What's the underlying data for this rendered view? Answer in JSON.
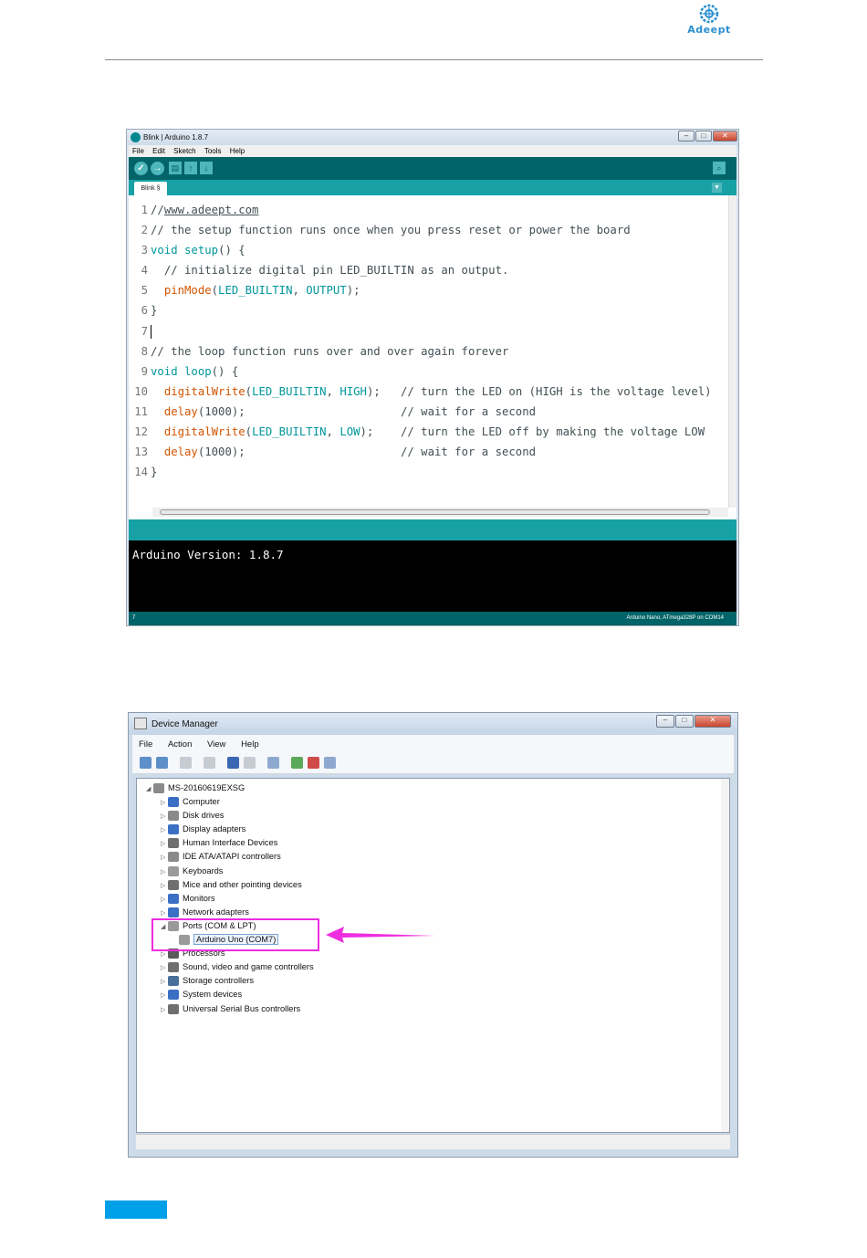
{
  "brand": {
    "logo_text": "Adeept"
  },
  "arduino": {
    "title": "Blink | Arduino 1.8.7",
    "menu": [
      "File",
      "Edit",
      "Sketch",
      "Tools",
      "Help"
    ],
    "tab": "Blink §",
    "code_lines": [
      {
        "n": "1",
        "text": "//www.adeept.com"
      },
      {
        "n": "2",
        "text": "// the setup function runs once when you press reset or power the board"
      },
      {
        "n": "3",
        "text": "void setup() {"
      },
      {
        "n": "4",
        "text": "  // initialize digital pin LED_BUILTIN as an output."
      },
      {
        "n": "5",
        "text": "  pinMode(LED_BUILTIN, OUTPUT);"
      },
      {
        "n": "6",
        "text": "}"
      },
      {
        "n": "7",
        "text": ""
      },
      {
        "n": "8",
        "text": "// the loop function runs over and over again forever"
      },
      {
        "n": "9",
        "text": "void loop() {"
      },
      {
        "n": "10",
        "text": "  digitalWrite(LED_BUILTIN, HIGH);   // turn the LED on (HIGH is the voltage level)"
      },
      {
        "n": "11",
        "text": "  delay(1000);                       // wait for a second"
      },
      {
        "n": "12",
        "text": "  digitalWrite(LED_BUILTIN, LOW);    // turn the LED off by making the voltage LOW"
      },
      {
        "n": "13",
        "text": "  delay(1000);                       // wait for a second"
      },
      {
        "n": "14",
        "text": "}"
      }
    ],
    "console_text": "Arduino Version: 1.8.7",
    "footer_left": "7",
    "footer_right": "Arduino Nano, ATmega328P on COM14"
  },
  "device_manager": {
    "title": "Device Manager",
    "menu": [
      "File",
      "Action",
      "View",
      "Help"
    ],
    "root": "MS-20160619EXSG",
    "categories": [
      {
        "label": "Computer",
        "icon": "computer-icon",
        "color": "#3b6fc4"
      },
      {
        "label": "Disk drives",
        "icon": "disk-icon",
        "color": "#8a8a8a"
      },
      {
        "label": "Display adapters",
        "icon": "display-icon",
        "color": "#3b6fc4"
      },
      {
        "label": "Human Interface Devices",
        "icon": "hid-icon",
        "color": "#6f6f6f"
      },
      {
        "label": "IDE ATA/ATAPI controllers",
        "icon": "ide-icon",
        "color": "#8a8a8a"
      },
      {
        "label": "Keyboards",
        "icon": "keyboard-icon",
        "color": "#9a9a9a"
      },
      {
        "label": "Mice and other pointing devices",
        "icon": "mouse-icon",
        "color": "#6f6f6f"
      },
      {
        "label": "Monitors",
        "icon": "monitor-icon",
        "color": "#3b6fc4"
      },
      {
        "label": "Network adapters",
        "icon": "network-icon",
        "color": "#3b6fc4"
      },
      {
        "label": "Ports (COM & LPT)",
        "icon": "port-icon",
        "color": "#9a9a9a",
        "expanded": true
      },
      {
        "label": "Processors",
        "icon": "processor-icon",
        "color": "#5a5a5a"
      },
      {
        "label": "Sound, video and game controllers",
        "icon": "sound-icon",
        "color": "#6f6f6f"
      },
      {
        "label": "Storage controllers",
        "icon": "storage-icon",
        "color": "#4a6f9a"
      },
      {
        "label": "System devices",
        "icon": "system-icon",
        "color": "#3b6fc4"
      },
      {
        "label": "Universal Serial Bus controllers",
        "icon": "usb-icon",
        "color": "#6f6f6f"
      }
    ],
    "port_child": "Arduino Uno (COM7)"
  },
  "colors": {
    "highlight": "#ee2de0",
    "arduino_teal": "#006468",
    "accent": "#00a0e9"
  }
}
